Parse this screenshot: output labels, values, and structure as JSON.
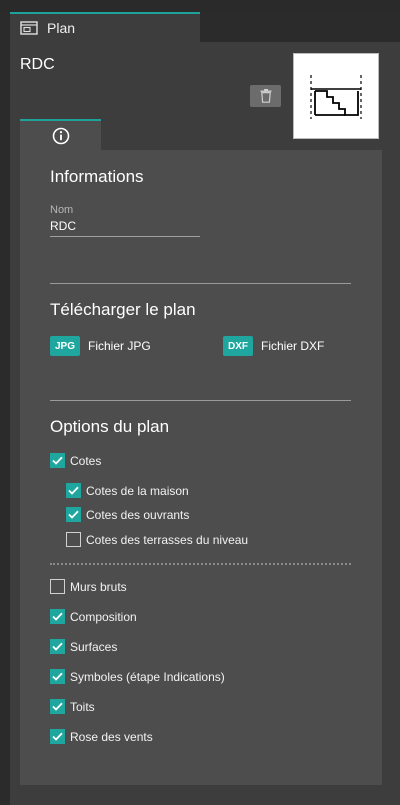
{
  "window": {
    "tab_title": "Plan",
    "tab_icon": "plan-window-icon"
  },
  "level": {
    "name": "RDC",
    "delete_icon": "trash-icon"
  },
  "info_tab": {
    "icon": "info-icon"
  },
  "informations": {
    "title": "Informations",
    "nom_label": "Nom",
    "nom_value": "RDC"
  },
  "download": {
    "title": "Télécharger le plan",
    "jpg": {
      "badge": "JPG",
      "label": "Fichier JPG"
    },
    "dxf": {
      "badge": "DXF",
      "label": "Fichier DXF"
    }
  },
  "options": {
    "title": "Options du plan",
    "items": [
      {
        "label": "Cotes",
        "checked": true
      },
      {
        "label": "Cotes de la maison",
        "checked": true
      },
      {
        "label": "Cotes des ouvrants",
        "checked": true
      },
      {
        "label": "Cotes des terrasses du niveau",
        "checked": false
      },
      {
        "label": "Murs bruts",
        "checked": false
      },
      {
        "label": "Composition",
        "checked": true
      },
      {
        "label": "Surfaces",
        "checked": true
      },
      {
        "label": "Symboles (étape Indications)",
        "checked": true
      },
      {
        "label": "Toits",
        "checked": true
      },
      {
        "label": "Rose des vents",
        "checked": true
      }
    ]
  },
  "colors": {
    "accent": "#1fa69f",
    "panel": "#3d3d3d",
    "content": "#4d4d4d"
  }
}
